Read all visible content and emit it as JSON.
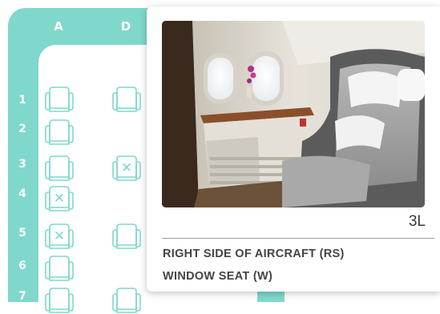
{
  "seatmap": {
    "columns": [
      "A",
      "D"
    ],
    "rows": [
      "1",
      "2",
      "3",
      "4",
      "5",
      "6",
      "7"
    ],
    "colors": {
      "teal": "#7fd8cb",
      "white": "#ffffff"
    },
    "seats": [
      {
        "row": "1",
        "col": "A",
        "status": "available"
      },
      {
        "row": "1",
        "col": "D",
        "status": "available"
      },
      {
        "row": "2",
        "col": "A",
        "status": "available"
      },
      {
        "row": "3",
        "col": "A",
        "status": "available"
      },
      {
        "row": "3",
        "col": "D",
        "status": "occupied"
      },
      {
        "row": "4",
        "col": "A",
        "status": "occupied"
      },
      {
        "row": "5",
        "col": "A",
        "status": "occupied"
      },
      {
        "row": "5",
        "col": "D",
        "status": "available"
      },
      {
        "row": "6",
        "col": "A",
        "status": "available"
      },
      {
        "row": "7",
        "col": "A",
        "status": "available"
      },
      {
        "row": "7",
        "col": "D",
        "status": "available"
      }
    ],
    "occupied_mark": "✕"
  },
  "popup": {
    "photo_icon": "first-class-seat-photo",
    "seat_code": "3L",
    "line1": "RIGHT SIDE OF AIRCRAFT (RS)",
    "line2": "WINDOW SEAT (W)"
  }
}
